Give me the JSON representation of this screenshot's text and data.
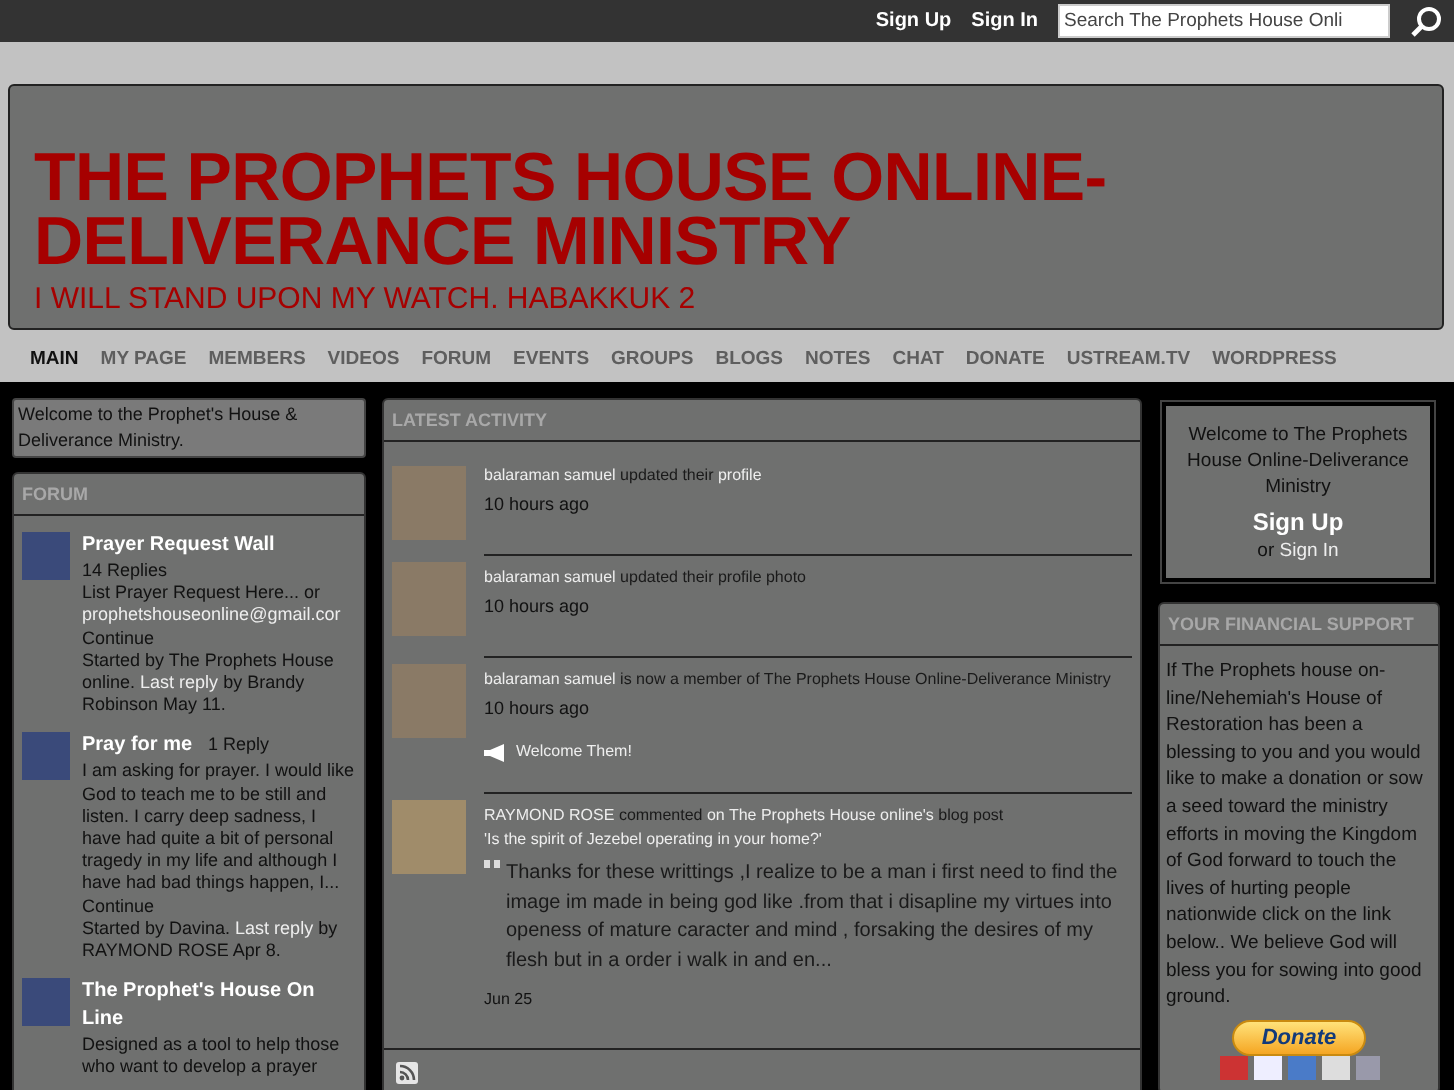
{
  "top_bar": {
    "links": [
      "Sign Up",
      "Sign In"
    ],
    "search": {
      "placeholder": "Search The Prophets House Onli"
    }
  },
  "header": {
    "title": "THE PROPHETS HOUSE ONLINE-DELIVERANCE MINISTRY",
    "tagline": "I WILL STAND UPON MY WATCH. HABAKKUK 2"
  },
  "nav": [
    {
      "label": "MAIN",
      "selected": true
    },
    {
      "label": "MY PAGE",
      "selected": false
    },
    {
      "label": "MEMBERS",
      "selected": false
    },
    {
      "label": "VIDEOS",
      "selected": false
    },
    {
      "label": "FORUM",
      "selected": false
    },
    {
      "label": "EVENTS",
      "selected": false
    },
    {
      "label": "GROUPS",
      "selected": false
    },
    {
      "label": "BLOGS",
      "selected": false
    },
    {
      "label": "NOTES",
      "selected": false
    },
    {
      "label": "CHAT",
      "selected": false
    },
    {
      "label": "DONATE",
      "selected": false
    },
    {
      "label": "USTREAM.TV",
      "selected": false
    },
    {
      "label": "WORDPRESS",
      "selected": false
    }
  ],
  "welcome_text": "Welcome to the Prophet's House & Deliverance Ministry.",
  "forum": {
    "title": "FORUM",
    "topics": [
      {
        "title": "Prayer Request Wall",
        "replies": "14 Replies",
        "excerpt": "List Prayer Request Here... or",
        "email": "prophetshouseonline@gmail.cor",
        "continue": "Continue",
        "started": "Started by The Prophets House online.",
        "last_reply": "Last reply",
        "by": "by Brandy Robinson May 11."
      },
      {
        "title": "Pray for me",
        "replies": "1 Reply",
        "excerpt": "I am asking for prayer. I would like God to teach me to be still and listen. I carry deep sadness, I have had quite a bit of personal tragedy in my life and although I have had bad things happen, I...",
        "continue": "Continue",
        "started": "Started by Davina.",
        "last_reply": "Last reply",
        "by": "by RAYMOND ROSE Apr 8."
      },
      {
        "title": "The Prophet's House On Line",
        "excerpt": "Designed as a tool to help those who want to develop a prayer"
      }
    ]
  },
  "activity": {
    "title": "LATEST ACTIVITY",
    "items": [
      {
        "kind": "update",
        "segments": [
          {
            "text": "balaraman samuel",
            "link": true
          },
          {
            "text": "updated their",
            "link": false
          },
          {
            "text": "profile",
            "link": true
          }
        ],
        "time": "10 hours ago"
      },
      {
        "kind": "update",
        "segments": [
          {
            "text": "balaraman samuel",
            "link": true
          },
          {
            "text": "updated their profile photo",
            "link": false
          }
        ],
        "time": "10 hours ago"
      },
      {
        "kind": "update",
        "segments": [
          {
            "text": "balaraman samuel",
            "link": true
          },
          {
            "text": "is now a member of The Prophets House Online-Deliverance Ministry",
            "link": false
          }
        ],
        "time": "10 hours ago",
        "action": "Welcome Them!"
      },
      {
        "kind": "comment",
        "segments": [
          {
            "text": "RAYMOND ROSE",
            "link": true
          },
          {
            "text": "commented",
            "link": false
          },
          {
            "text": "on",
            "link": true
          },
          {
            "text": "The Prophets House online's",
            "link": true
          },
          {
            "text": "blog post",
            "link": false
          },
          {
            "text": "'Is the spirit of Jezebel operating in your home?'",
            "link": true
          }
        ],
        "quote": "Thanks for these writtings ,I realize to be a man i first need to find the image im made in being god like .from that i disapline my virtues into openess of mature caracter and mind , forsaking the desires of my flesh but in a order i walk in and en...",
        "time": "Jun 25"
      }
    ]
  },
  "signin_box": {
    "welcome": "Welcome to The Prophets House Online-Deliverance Ministry",
    "sign_up": "Sign Up",
    "or": "or",
    "sign_in": "Sign In"
  },
  "support": {
    "title": "YOUR FINANCIAL SUPPORT",
    "text": "If The Prophets house on-line/Nehemiah's House of Restoration has been a blessing to you and you would like to make a donation or sow a seed toward the ministry efforts in moving the Kingdom of God forward to touch the lives of hurting people nationwide click on the link below.. We believe God will bless you for sowing into good ground.",
    "button": "Donate"
  }
}
